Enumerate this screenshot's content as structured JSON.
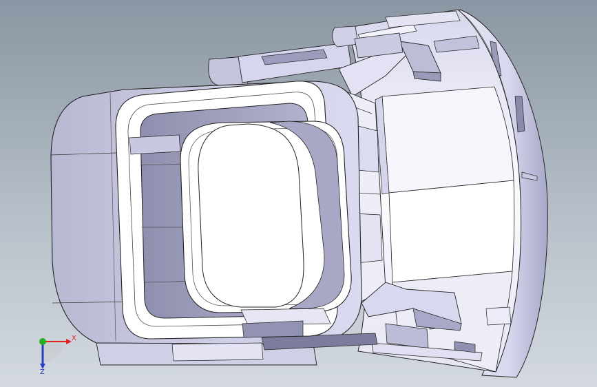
{
  "viewport": {
    "background_top": "#8a96a3",
    "background_bottom": "#d3d9df",
    "model_color": "#d4d4ee"
  },
  "triad": {
    "x_label": "X",
    "z_label": "Z",
    "x_color": "#e02020",
    "y_color": "#22b022",
    "z_color": "#2a3ec0"
  }
}
